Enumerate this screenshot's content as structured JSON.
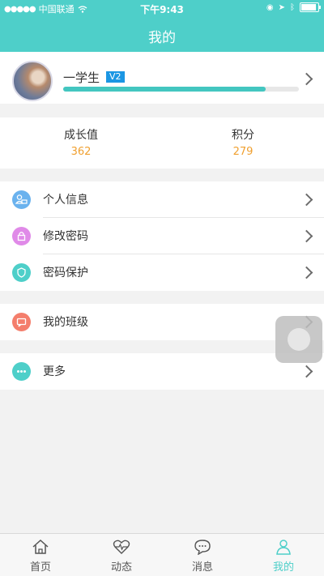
{
  "status_bar": {
    "carrier": "中国联通",
    "time": "下午9:43"
  },
  "header": {
    "title": "我的"
  },
  "profile": {
    "username": "一学生",
    "level_badge": "V2",
    "progress_fraction": 0.86
  },
  "stats": [
    {
      "label": "成长值",
      "value": "362"
    },
    {
      "label": "积分",
      "value": "279"
    }
  ],
  "menu_group_1": [
    {
      "label": "个人信息",
      "icon": "person-card-icon",
      "color": "#6ab2ee"
    },
    {
      "label": "修改密码",
      "icon": "lock-icon",
      "color": "#e08ae8"
    },
    {
      "label": "密码保护",
      "icon": "shield-icon",
      "color": "#4ecfc9"
    }
  ],
  "menu_group_2": [
    {
      "label": "我的班级",
      "icon": "chat-bubble-icon",
      "color": "#f47e6c"
    }
  ],
  "menu_group_3": [
    {
      "label": "更多",
      "icon": "more-dots-icon",
      "color": "#4ecfc9"
    }
  ],
  "tabbar": {
    "tabs": [
      {
        "label": "首页",
        "icon": "home-icon"
      },
      {
        "label": "动态",
        "icon": "heart-pulse-icon"
      },
      {
        "label": "消息",
        "icon": "message-icon"
      },
      {
        "label": "我的",
        "icon": "person-icon"
      }
    ],
    "active_index": 3,
    "accent_color": "#4ecfc9"
  },
  "colors": {
    "header": "#4ecfc9",
    "badge": "#1b96e3",
    "stat_value": "#f0a030"
  }
}
